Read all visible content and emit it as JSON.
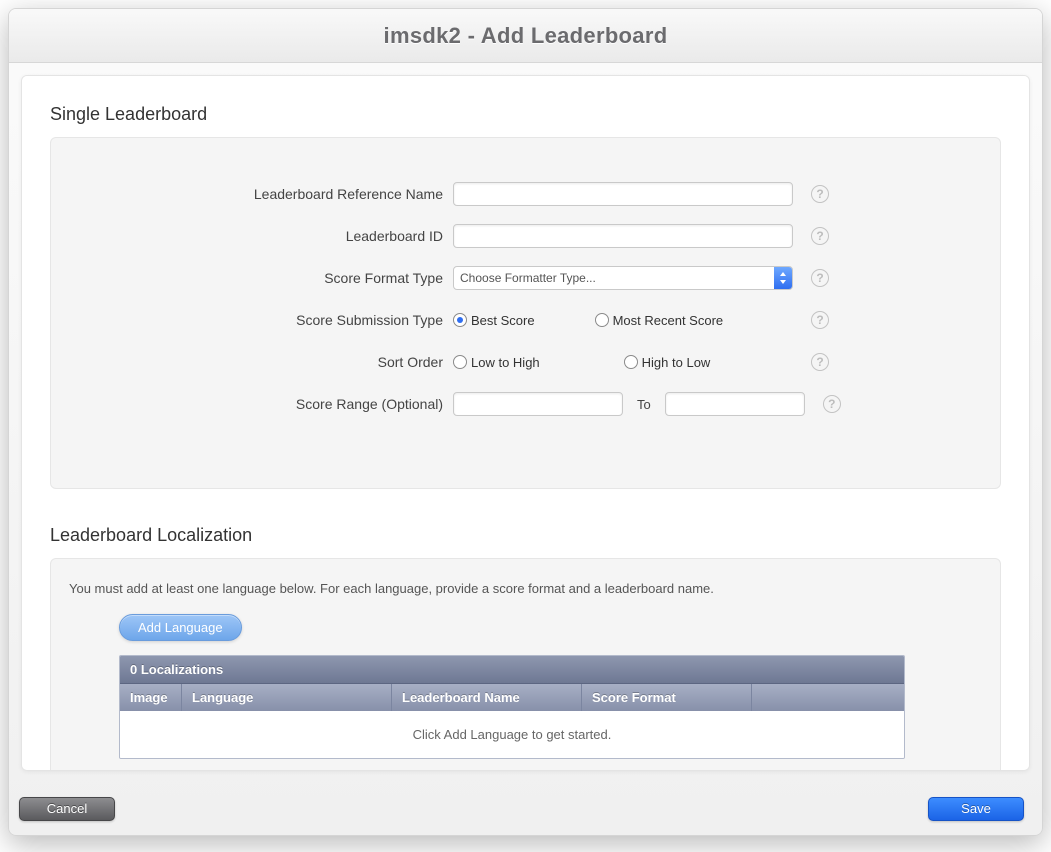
{
  "title": "imsdk2 - Add Leaderboard",
  "section1": {
    "heading": "Single Leaderboard",
    "fields": {
      "ref_name": {
        "label": "Leaderboard Reference Name",
        "value": ""
      },
      "lb_id": {
        "label": "Leaderboard ID",
        "value": ""
      },
      "format": {
        "label": "Score Format Type",
        "selected": "Choose Formatter Type..."
      },
      "submission": {
        "label": "Score Submission Type",
        "opt_best": "Best Score",
        "opt_recent": "Most Recent Score",
        "selected": "best"
      },
      "sort": {
        "label": "Sort Order",
        "opt_low": "Low to High",
        "opt_high": "High to Low",
        "selected": ""
      },
      "range": {
        "label": "Score Range (Optional)",
        "from": "",
        "to_word": "To",
        "to": ""
      }
    }
  },
  "section2": {
    "heading": "Leaderboard Localization",
    "hint": "You must add at least one language below. For each language, provide a score format and a leaderboard name.",
    "add_button": "Add Language",
    "table": {
      "count_header": "0 Localizations",
      "cols": {
        "image": "Image",
        "language": "Language",
        "name": "Leaderboard Name",
        "format": "Score Format"
      },
      "empty_msg": "Click Add Language to get started."
    }
  },
  "footer": {
    "cancel": "Cancel",
    "save": "Save"
  }
}
